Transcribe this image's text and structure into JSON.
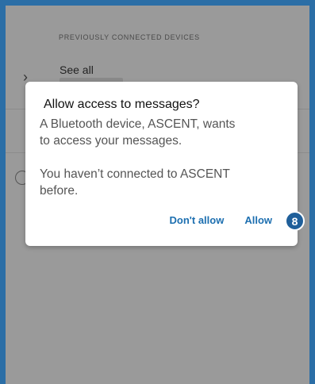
{
  "background": {
    "section_header": "PREVIOUSLY CONNECTED DEVICES",
    "see_all_label": "See all"
  },
  "dialog": {
    "title": "Allow access to messages?",
    "message_line1": "A Bluetooth device, ASCENT, wants",
    "message_line2": "to access your messages.",
    "message_line3": "You haven’t connected to ASCENT",
    "message_line4": "before.",
    "deny_label": "Don't allow",
    "allow_label": "Allow"
  },
  "annotation": {
    "badge_number": "8"
  },
  "colors": {
    "frame": "#2b6ea6",
    "scrim": "#9a9a9a",
    "button_text": "#1d6fb0",
    "badge": "#1f5f9a"
  }
}
